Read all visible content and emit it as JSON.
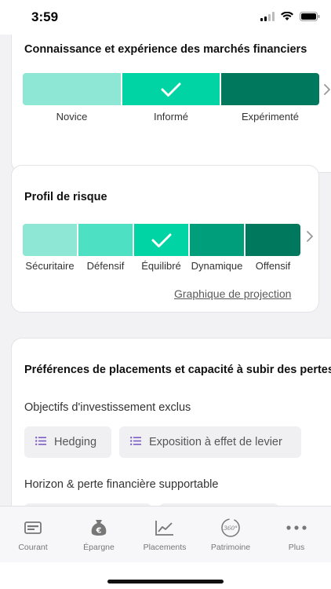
{
  "status_bar": {
    "time": "3:59"
  },
  "knowledge": {
    "title": "Connaissance et expérience des marchés financiers",
    "levels": [
      {
        "label": "Novice",
        "color": "#8ee6d4"
      },
      {
        "label": "Informé",
        "color": "#00d4a4"
      },
      {
        "label": "Expérimenté",
        "color": "#00785d"
      }
    ],
    "selected": "Informé"
  },
  "risk": {
    "title": "Profil de risque",
    "levels": [
      {
        "label": "Sécuritaire",
        "color": "#8ee6d4"
      },
      {
        "label": "Défensif",
        "color": "#4de0c2"
      },
      {
        "label": "Équilibré",
        "color": "#00d4a4"
      },
      {
        "label": "Dynamique",
        "color": "#009e7b"
      },
      {
        "label": "Offensif",
        "color": "#00785d"
      }
    ],
    "selected": "Équilibré",
    "link": "Graphique de projection"
  },
  "preferences": {
    "title": "Préférences de placements et capacité à subir des pertes",
    "excluded_label": "Objectifs d'investissement exclus",
    "chips": [
      "Hedging",
      "Exposition à effet de levier"
    ],
    "horizon_label": "Horizon & perte financière supportable"
  },
  "tabbar": {
    "items": [
      {
        "label": "Courant",
        "icon": "account-card-icon"
      },
      {
        "label": "Épargne",
        "icon": "money-bag-euro-icon"
      },
      {
        "label": "Placements",
        "icon": "line-chart-icon"
      },
      {
        "label": "Patrimoine",
        "icon": "360-icon"
      },
      {
        "label": "Plus",
        "icon": "more-dots-icon"
      }
    ]
  },
  "colors": {
    "accent_purple": "#7b5cc4",
    "tab_icon": "#777777"
  }
}
